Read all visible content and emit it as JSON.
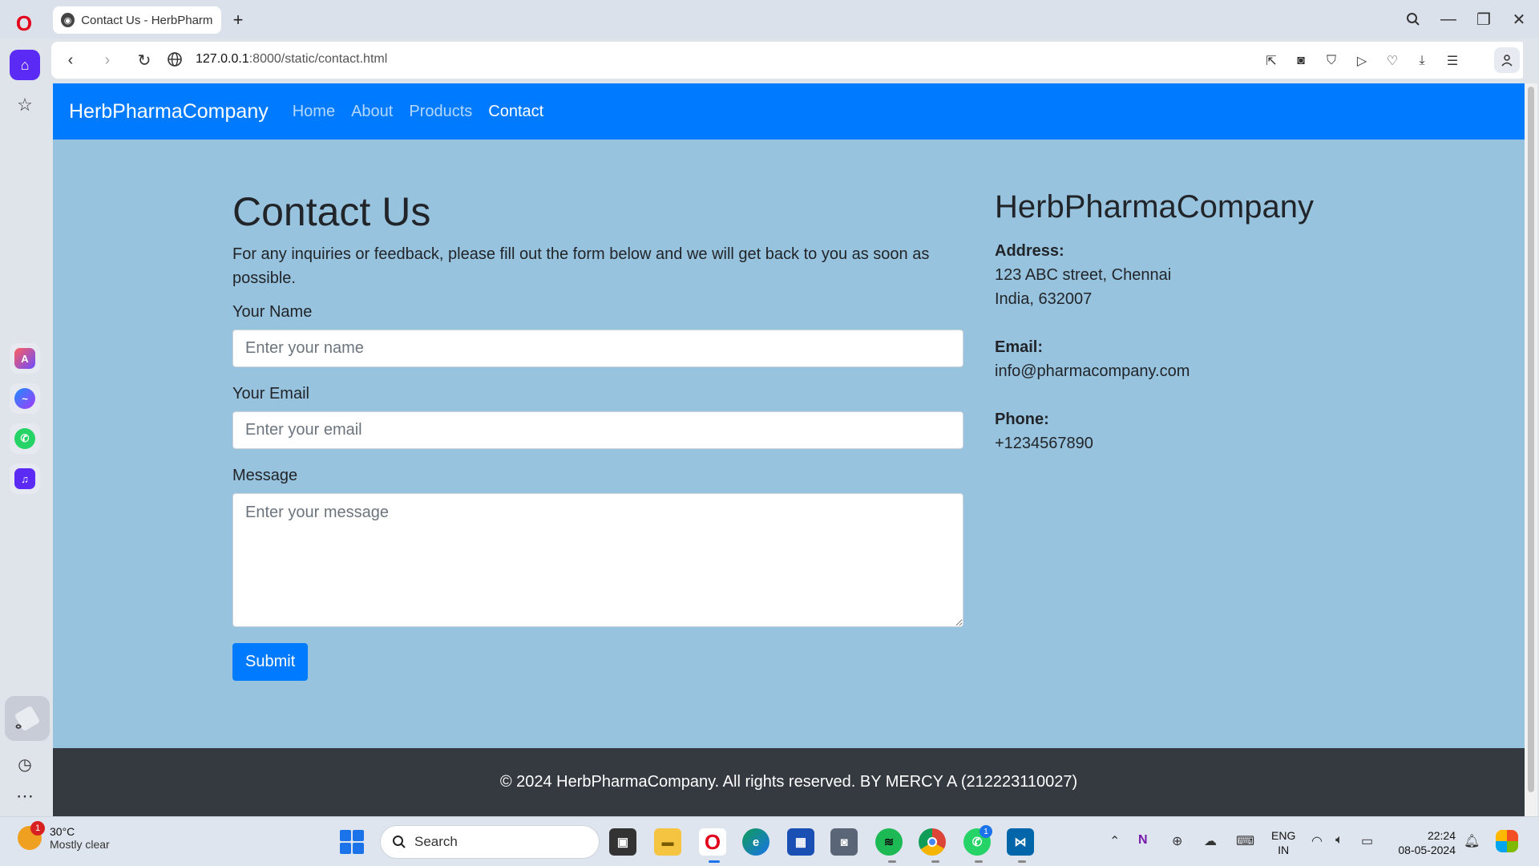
{
  "browser": {
    "tab_title": "Contact Us - HerbPharma",
    "url_host": "127.0.0.1",
    "url_rest": ":8000/static/contact.html"
  },
  "site": {
    "brand": "HerbPharmaCompany",
    "nav": [
      "Home",
      "About",
      "Products",
      "Contact"
    ],
    "active_nav": "Contact"
  },
  "contact": {
    "title": "Contact Us",
    "description": "For any inquiries or feedback, please fill out the form below and we will get back to you as soon as possible.",
    "name_label": "Your Name",
    "name_placeholder": "Enter your name",
    "email_label": "Your Email",
    "email_placeholder": "Enter your email",
    "message_label": "Message",
    "message_placeholder": "Enter your message",
    "submit_label": "Submit"
  },
  "info": {
    "company": "HerbPharmaCompany",
    "address_label": "Address:",
    "address_line1": "123 ABC street, Chennai",
    "address_line2": "India, 632007",
    "email_label": "Email:",
    "email": "info@pharmacompany.com",
    "phone_label": "Phone:",
    "phone": "+1234567890"
  },
  "footer": {
    "text": "© 2024 HerbPharmaCompany. All rights reserved. BY MERCY A (212223110027)"
  },
  "taskbar": {
    "weather_temp": "30°C",
    "weather_desc": "Mostly clear",
    "weather_badge": "1",
    "search_label": "Search",
    "lang_line1": "ENG",
    "lang_line2": "IN",
    "time": "22:24",
    "date": "08-05-2024",
    "whatsapp_badge": "1"
  },
  "colors": {
    "nav_bg": "#007bff",
    "page_bg": "#98c3de",
    "footer_bg": "#343a40",
    "opera_accent": "#5b2bf5"
  }
}
